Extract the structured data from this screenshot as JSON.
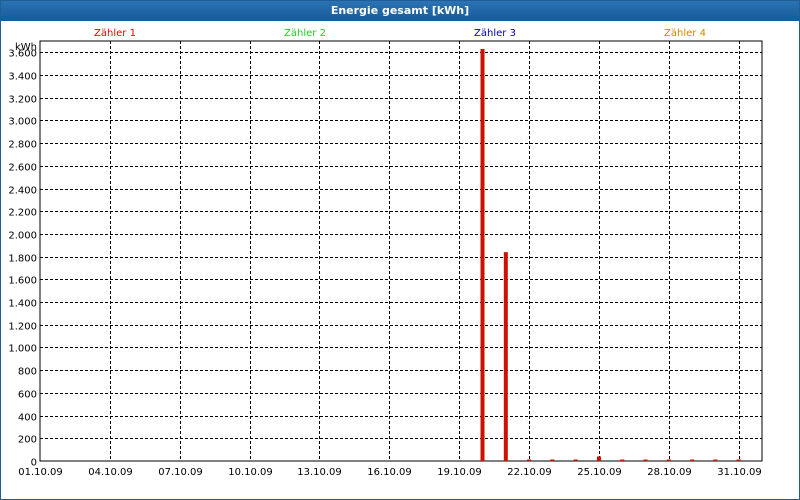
{
  "window": {
    "title": "Energie gesamt [kWh]"
  },
  "colors": {
    "title_bar": "#1e66a8",
    "zaehler1": "#cc0000",
    "zaehler2": "#22cc22",
    "zaehler3": "#0000aa",
    "zaehler4": "#cc8800",
    "bars": "#cc1100"
  },
  "chart_data": {
    "type": "bar",
    "title": "Energie gesamt [kWh]",
    "ylabel": "kWh",
    "xlabel": "",
    "ylim": [
      0,
      3700
    ],
    "yticks": [
      0,
      200,
      400,
      600,
      800,
      1000,
      1200,
      1400,
      1600,
      1800,
      2000,
      2200,
      2400,
      2600,
      2800,
      3000,
      3200,
      3400,
      3600
    ],
    "ytick_labels": [
      "0",
      "200",
      "400",
      "600",
      "800",
      "1.000",
      "1.200",
      "1.400",
      "1.600",
      "1.800",
      "2.000",
      "2.200",
      "2.400",
      "2.600",
      "2.800",
      "3.000",
      "3.200",
      "3.400",
      "3.600"
    ],
    "xtick_labels": [
      "01.10.09",
      "04.10.09",
      "07.10.09",
      "10.10.09",
      "13.10.09",
      "16.10.09",
      "19.10.09",
      "22.10.09",
      "25.10.09",
      "28.10.09",
      "31.10.09"
    ],
    "grid": true,
    "legend_position": "top",
    "series": [
      {
        "name": "Zähler 1",
        "color": "#cc1100",
        "points": [
          {
            "x": "20.10.09",
            "y": 3630
          },
          {
            "x": "21.10.09",
            "y": 1840
          },
          {
            "x": "22.10.09",
            "y": 5
          },
          {
            "x": "23.10.09",
            "y": 8
          },
          {
            "x": "24.10.09",
            "y": 5
          },
          {
            "x": "25.10.09",
            "y": 40
          },
          {
            "x": "26.10.09",
            "y": 8
          },
          {
            "x": "27.10.09",
            "y": 8
          },
          {
            "x": "28.10.09",
            "y": 8
          },
          {
            "x": "29.10.09",
            "y": 8
          },
          {
            "x": "30.10.09",
            "y": 8
          },
          {
            "x": "31.10.09",
            "y": 8
          }
        ]
      },
      {
        "name": "Zähler 2",
        "color": "#22cc22",
        "points": []
      },
      {
        "name": "Zähler 3",
        "color": "#0000aa",
        "points": []
      },
      {
        "name": "Zähler 4",
        "color": "#cc8800",
        "points": []
      }
    ]
  }
}
